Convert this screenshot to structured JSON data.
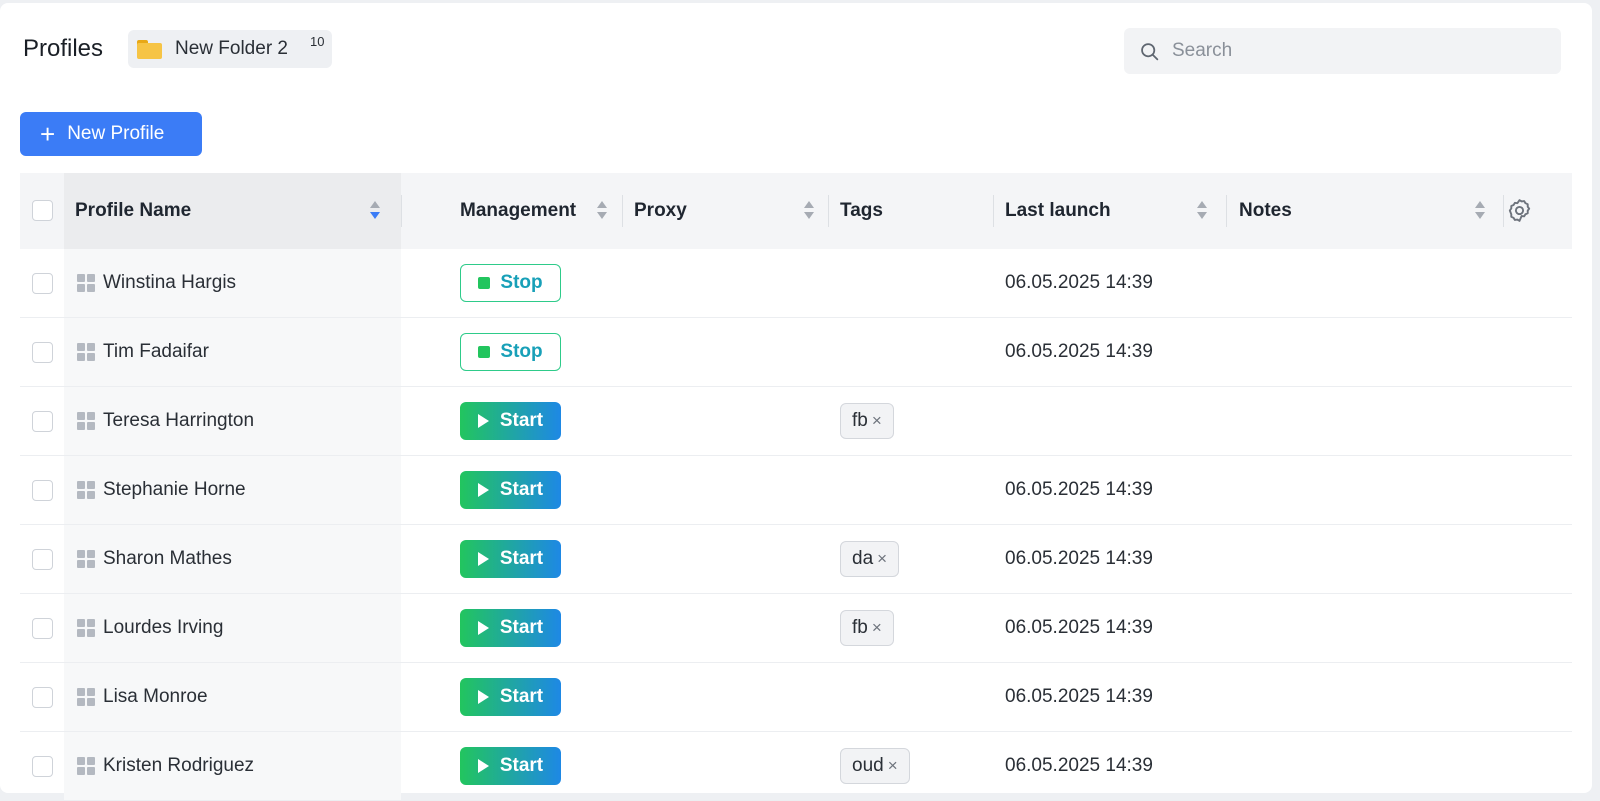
{
  "header": {
    "title": "Profiles",
    "folder_name": "New Folder 2",
    "folder_count": "10"
  },
  "search": {
    "placeholder": "Search",
    "value": ""
  },
  "toolbar": {
    "new_profile_label": "New Profile"
  },
  "columns": {
    "profile_name": "Profile Name",
    "management": "Management",
    "proxy": "Proxy",
    "tags": "Tags",
    "last_launch": "Last launch",
    "notes": "Notes"
  },
  "colors": {
    "accent": "#3b7cf6",
    "start_from": "#22c55e",
    "start_to": "#1e88e5",
    "stop_border": "#2ecb8a",
    "stop_text": "#18a0b8"
  },
  "rows": [
    {
      "name": "Winstina Hargis",
      "status": "stop",
      "action": "Stop",
      "tag": "",
      "last_launch": "06.05.2025 14:39"
    },
    {
      "name": "Tim Fadaifar",
      "status": "stop",
      "action": "Stop",
      "tag": "",
      "last_launch": "06.05.2025 14:39"
    },
    {
      "name": "Teresa Harrington",
      "status": "start",
      "action": "Start",
      "tag": "fb",
      "last_launch": ""
    },
    {
      "name": "Stephanie Horne",
      "status": "start",
      "action": "Start",
      "tag": "",
      "last_launch": "06.05.2025 14:39"
    },
    {
      "name": "Sharon Mathes",
      "status": "start",
      "action": "Start",
      "tag": "da",
      "last_launch": "06.05.2025 14:39"
    },
    {
      "name": "Lourdes Irving",
      "status": "start",
      "action": "Start",
      "tag": "fb",
      "last_launch": "06.05.2025 14:39"
    },
    {
      "name": "Lisa Monroe",
      "status": "start",
      "action": "Start",
      "tag": "",
      "last_launch": "06.05.2025 14:39"
    },
    {
      "name": "Kristen Rodriguez",
      "status": "start",
      "action": "Start",
      "tag": "oud",
      "last_launch": "06.05.2025 14:39"
    }
  ]
}
